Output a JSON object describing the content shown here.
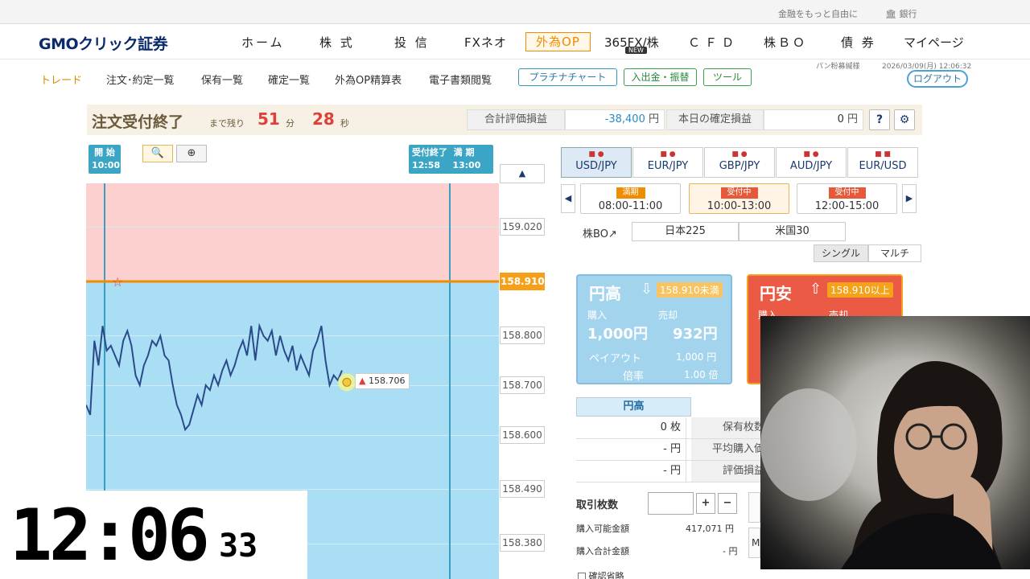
{
  "topbar": {
    "tagline": "金融をもっと自由に",
    "bank": "銀行"
  },
  "brand": {
    "logo_text": "GMOクリック証券"
  },
  "nav": [
    {
      "label": "ホーム"
    },
    {
      "label": "株 式"
    },
    {
      "label": "投 信"
    },
    {
      "label": "FXネオ"
    },
    {
      "label": "外為OP"
    },
    {
      "label": "365FX/株"
    },
    {
      "label": "ＣＦＤ"
    },
    {
      "label": "株ＢＯ"
    },
    {
      "label": "債 券"
    },
    {
      "label": "マイページ"
    }
  ],
  "nav_new_badge": "NEW",
  "subnav": {
    "links": [
      "トレード",
      "注文･約定一覧",
      "保有一覧",
      "確定一覧",
      "外為OP精算表",
      "電子書類閲覧"
    ],
    "buttons": [
      "プラチナチャート",
      "入出金・振替",
      "ツール"
    ],
    "logout": "ログアウト",
    "user": "パン粉募緘様",
    "datetime": "2026/03/09(月) 12:06:32"
  },
  "status": {
    "title": "注文受付終了",
    "remaining_label": "まで残り",
    "minutes": "51",
    "min_unit": "分",
    "seconds": "28",
    "sec_unit": "秒",
    "total_pl_label": "合計評価損益",
    "total_pl_value": "-38,400",
    "yen": "円",
    "daily_pl_label": "本日の確定損益",
    "daily_pl_value": "0",
    "help": "?"
  },
  "chart_controls": {
    "start_label": "開 始",
    "start_time": "10:00",
    "cutoff_label": "受付終了",
    "cutoff_time": "12:58",
    "expiry_label": "満 期",
    "expiry_time": "13:00",
    "scale_up": "▲"
  },
  "chart_data": {
    "type": "line",
    "title": "",
    "xlabel": "",
    "ylabel": "",
    "ylim": [
      158.3,
      159.1
    ],
    "target": 158.91,
    "current": 158.706,
    "current_label": "158.706",
    "ticks": [
      "159.020",
      "158.910",
      "158.800",
      "158.700",
      "158.600",
      "158.490",
      "158.380"
    ],
    "series": [
      {
        "values": [
          158.66,
          158.64,
          158.79,
          158.74,
          158.82,
          158.77,
          158.78,
          158.76,
          158.74,
          158.79,
          158.81,
          158.78,
          158.72,
          158.7,
          158.74,
          158.76,
          158.79,
          158.78,
          158.8,
          158.76,
          158.75,
          158.7,
          158.66,
          158.64,
          158.61,
          158.62,
          158.65,
          158.68,
          158.66,
          158.7,
          158.69,
          158.72,
          158.7,
          158.73,
          158.75,
          158.72,
          158.74,
          158.77,
          158.79,
          158.76,
          158.82,
          158.75,
          158.82,
          158.8,
          158.79,
          158.81,
          158.76,
          158.8,
          158.77,
          158.75,
          158.78,
          158.73,
          158.76,
          158.74,
          158.72,
          158.77,
          158.79,
          158.82,
          158.75,
          158.7,
          158.72,
          158.71,
          158.73
        ]
      }
    ]
  },
  "pairs": [
    {
      "label": "USD/JPY",
      "flags": "■ ●"
    },
    {
      "label": "EUR/JPY",
      "flags": "■ ●"
    },
    {
      "label": "GBP/JPY",
      "flags": "■ ●"
    },
    {
      "label": "AUD/JPY",
      "flags": "■ ●"
    },
    {
      "label": "EUR/USD",
      "flags": "■ ■"
    }
  ],
  "sessions": [
    {
      "badge": "満期",
      "time": "08:00-11:00"
    },
    {
      "badge": "受付中",
      "time": "10:00-13:00"
    },
    {
      "badge": "受付中",
      "time": "12:00-15:00"
    }
  ],
  "stock": {
    "link": "株BO↗",
    "tabs": [
      "日本225",
      "米国30"
    ]
  },
  "modes": [
    "シングル",
    "マルチ"
  ],
  "card_high": {
    "title": "円高",
    "condition": "158.910未満",
    "buy_label": "購入",
    "sell_label": "売却",
    "buy_price": "1,000",
    "sell_price": "932",
    "yen": "円",
    "payout_label": "ペイアウト",
    "payout_value": "1,000",
    "ratio_label": "倍率",
    "ratio_value": "1.00",
    "ratio_unit": "倍"
  },
  "card_low": {
    "title": "円安",
    "condition": "158.910以上",
    "buy_label": "購入",
    "sell_label": "売却"
  },
  "positions": {
    "header": "円高",
    "rows": [
      {
        "value": "0 枚",
        "label": "保有枚数"
      },
      {
        "value": "- 円",
        "label": "平均購入価"
      },
      {
        "value": "- 円",
        "label": "評価損益"
      }
    ]
  },
  "trade": {
    "qty_label": "取引枚数",
    "plus": "+",
    "minus": "−",
    "avail_label": "購入可能金額",
    "avail_value": "417,071 円",
    "total_label": "購入合計金額",
    "total_value": "- 円",
    "confirm_label": "確認省略"
  },
  "clock": {
    "hm": "12:06",
    "sec": "33"
  }
}
